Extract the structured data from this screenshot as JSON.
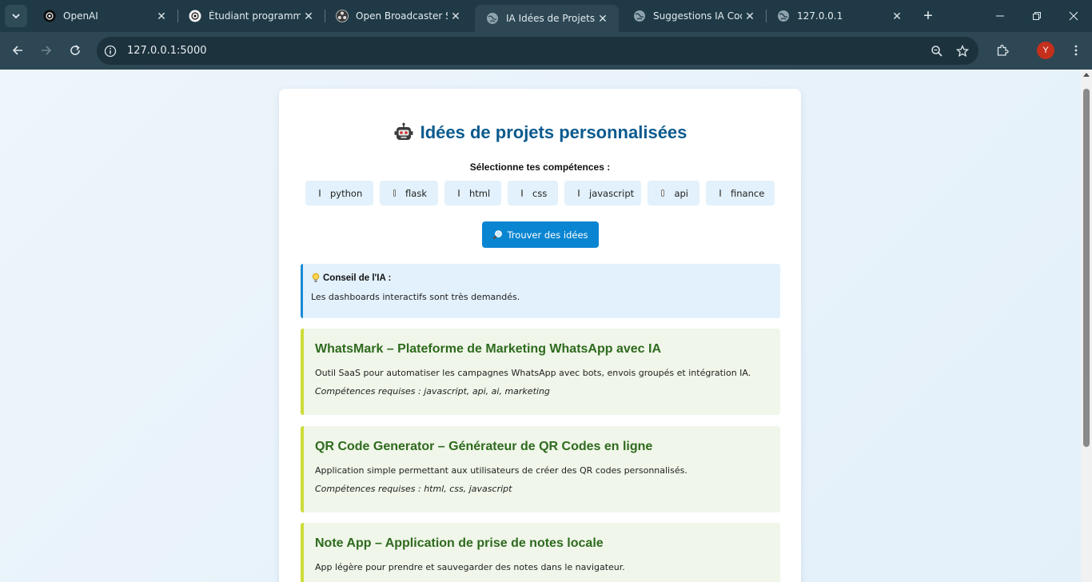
{
  "browser": {
    "tabs": [
      {
        "title": "OpenAI",
        "active": false
      },
      {
        "title": "Étudiant programmat",
        "active": false
      },
      {
        "title": "Open Broadcaster Sof",
        "active": false
      },
      {
        "title": "IA Idées de Projets - C",
        "active": true
      },
      {
        "title": "Suggestions IA Code",
        "active": false
      },
      {
        "title": "127.0.0.1",
        "active": false
      }
    ],
    "url": "127.0.0.1:5000",
    "profile_initial": "Y"
  },
  "page": {
    "title": "Idées de projets personnalisées",
    "skills_label": "Sélectionne tes compétences :",
    "skills": [
      "python",
      "flask",
      "html",
      "css",
      "javascript",
      "api",
      "finance"
    ],
    "find_button": "Trouver des idées",
    "tip": {
      "heading": "Conseil de l'IA :",
      "text": "Les dashboards interactifs sont très demandés."
    },
    "projects": [
      {
        "title": "WhatsMark – Plateforme de Marketing WhatsApp avec IA",
        "description": "Outil SaaS pour automatiser les campagnes WhatsApp avec bots, envois groupés et intégration IA.",
        "skills": "Compétences requises : javascript, api, ai, marketing"
      },
      {
        "title": "QR Code Generator – Générateur de QR Codes en ligne",
        "description": "Application simple permettant aux utilisateurs de créer des QR codes personnalisés.",
        "skills": "Compétences requises : html, css, javascript"
      },
      {
        "title": "Note App – Application de prise de notes locale",
        "description": "App légère pour prendre et sauvegarder des notes dans le navigateur.",
        "skills": ""
      }
    ]
  }
}
